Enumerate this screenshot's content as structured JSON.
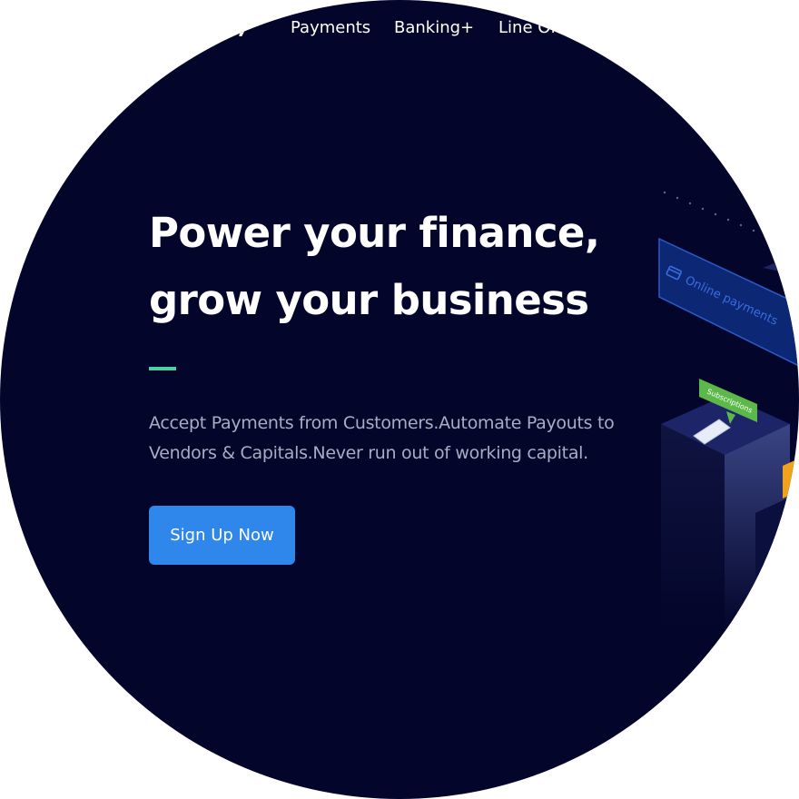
{
  "nav": {
    "items": [
      {
        "label": "Payments"
      },
      {
        "label": "Banking+"
      },
      {
        "label": "Line Of"
      }
    ]
  },
  "hero": {
    "title_line_1": "Power your finance,",
    "title_line_2": "grow your business",
    "subtitle_line_1": "Accept Payments from Customers.Automate Payouts to",
    "subtitle_line_2": "Vendors & Capitals.Never run out of working capital.",
    "cta_label": "Sign Up Now"
  },
  "illustration": {
    "online_card_label": "Online payments",
    "subscriptions_label": "Subscriptions",
    "card-icon": "credit-card-icon",
    "phone-icon": "smartphone-icon"
  },
  "colors": {
    "background": "#03052a",
    "accent_bar": "#4ecfa4",
    "cta": "#2f86eb",
    "subtitle_text": "#a9adc4",
    "subscriptions_tag": "#5cb848"
  }
}
